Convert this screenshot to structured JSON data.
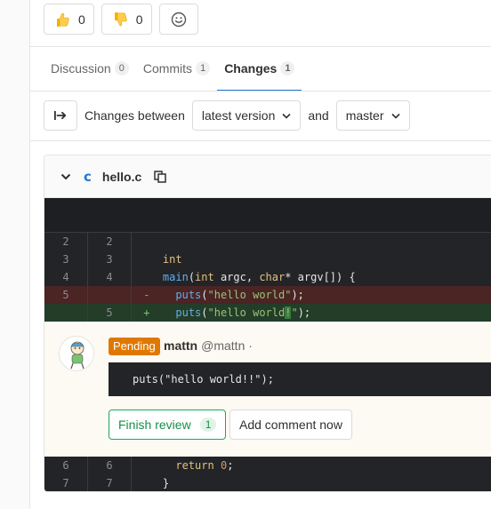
{
  "awards": [
    {
      "icon": "thumbs-up-icon",
      "count": "0"
    },
    {
      "icon": "thumbs-down-icon",
      "count": "0"
    },
    {
      "icon": "smiley-icon"
    }
  ],
  "tabs": [
    {
      "label": "Discussion",
      "count": "0",
      "active": false
    },
    {
      "label": "Commits",
      "count": "1",
      "active": false
    },
    {
      "label": "Changes",
      "count": "1",
      "active": true
    }
  ],
  "toolbar": {
    "changes_between": "Changes between",
    "version_select": "latest version",
    "and": "and",
    "target_select": "master"
  },
  "file": {
    "name": "hello.c",
    "lang_icon": "c"
  },
  "diff": {
    "lines": [
      {
        "old": "2",
        "new": "2",
        "type": "context",
        "marker": " ",
        "text": ""
      },
      {
        "old": "3",
        "new": "3",
        "type": "context",
        "marker": " ",
        "text": "int"
      },
      {
        "old": "4",
        "new": "4",
        "type": "context",
        "marker": " ",
        "text": "main(int argc, char* argv[]) {"
      },
      {
        "old": "5",
        "new": "",
        "type": "del",
        "marker": "-",
        "text": "  puts(\"hello world\");"
      },
      {
        "old": "",
        "new": "5",
        "type": "add",
        "marker": "+",
        "text": "  puts(\"hello world!\");"
      }
    ],
    "after_lines": [
      {
        "old": "6",
        "new": "6",
        "type": "context",
        "marker": " ",
        "text": "  return 0;"
      },
      {
        "old": "7",
        "new": "7",
        "type": "context",
        "marker": " ",
        "text": "}"
      }
    ]
  },
  "comment": {
    "badge": "Pending",
    "author_name": "mattn",
    "author_handle": "@mattn ·",
    "suggestion": "puts(\"hello world!!\");",
    "finish_review": "Finish review",
    "finish_count": "1",
    "add_comment": "Add comment now"
  },
  "colors": {
    "accent": "#1f78d1",
    "pending": "#e07800",
    "success": "#1aaa55",
    "diff_del": "#4b2424",
    "diff_add": "#233d28"
  }
}
